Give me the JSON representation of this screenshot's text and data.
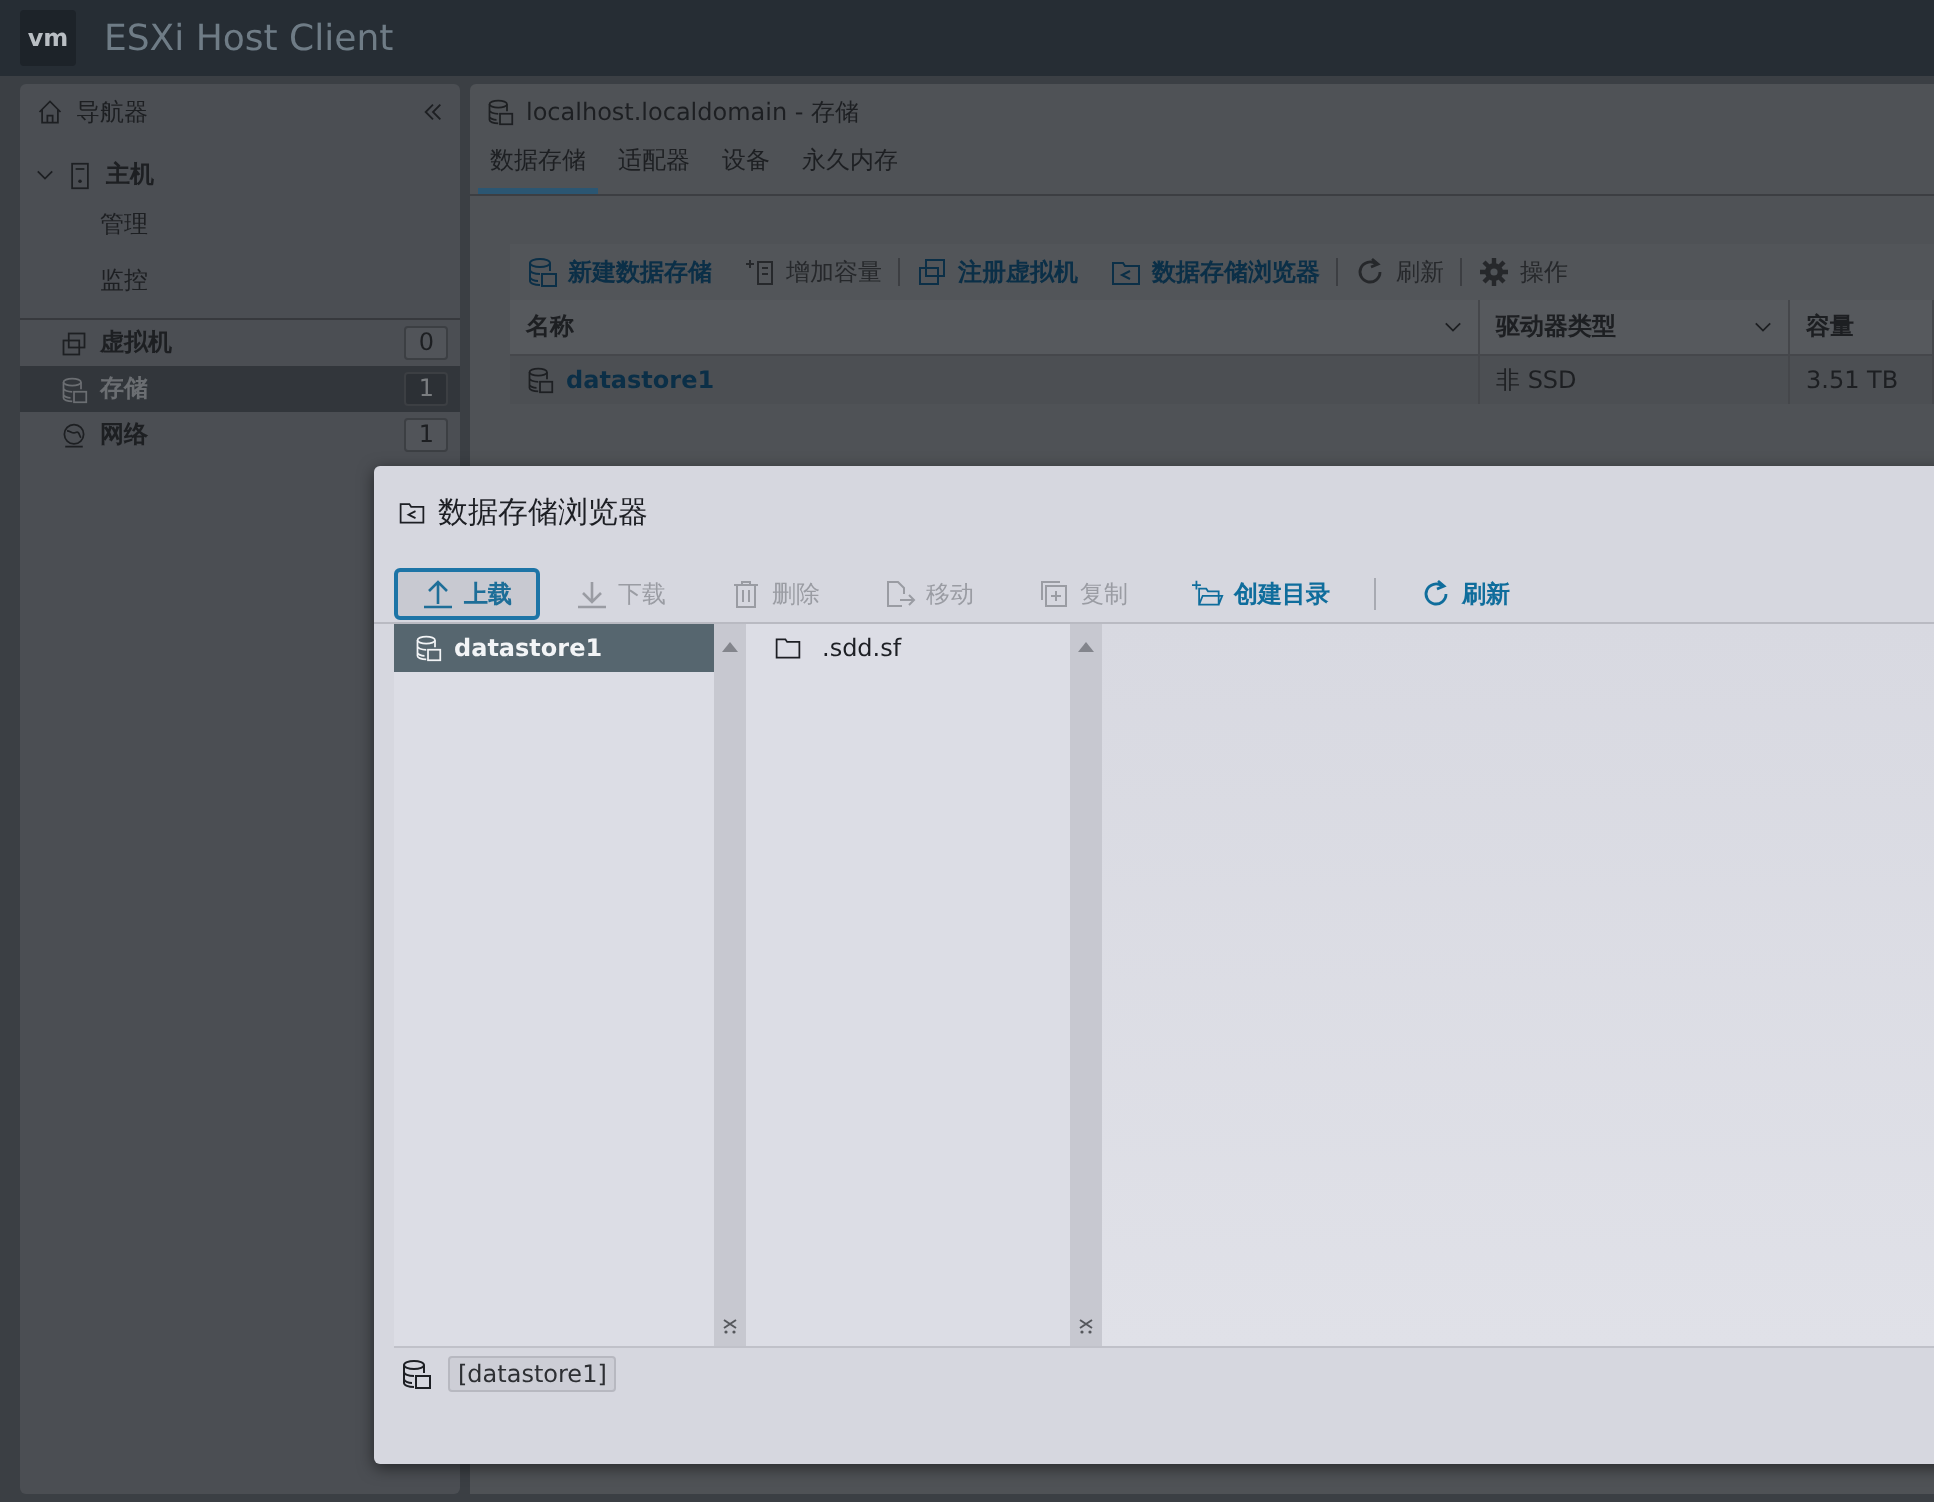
{
  "header": {
    "logo": "vm",
    "title": "ESXi Host Client"
  },
  "navigator": {
    "title": "导航器",
    "items": [
      {
        "kind": "host",
        "label": "主机",
        "expanded": true,
        "selected": false,
        "children": [
          {
            "label": "管理"
          },
          {
            "label": "监控"
          }
        ]
      },
      {
        "kind": "vm",
        "label": "虚拟机",
        "count": "0",
        "selected": false
      },
      {
        "kind": "storage",
        "label": "存储",
        "count": "1",
        "selected": true
      },
      {
        "kind": "network",
        "label": "网络",
        "count": "1",
        "selected": false
      }
    ]
  },
  "main": {
    "title": "localhost.localdomain - 存储",
    "tabs": [
      {
        "label": "数据存储",
        "selected": true
      },
      {
        "label": "适配器",
        "selected": false
      },
      {
        "label": "设备",
        "selected": false
      },
      {
        "label": "永久内存",
        "selected": false
      }
    ],
    "toolbar": [
      {
        "kind": "new",
        "label": "新建数据存储",
        "disabled": false
      },
      {
        "kind": "grow",
        "label": "增加容量",
        "disabled": true
      },
      {
        "kind": "sep"
      },
      {
        "kind": "register",
        "label": "注册虚拟机",
        "disabled": false
      },
      {
        "kind": "browser",
        "label": "数据存储浏览器",
        "disabled": false
      },
      {
        "kind": "sep"
      },
      {
        "kind": "refresh",
        "label": "刷新",
        "disabled": true
      },
      {
        "kind": "sep"
      },
      {
        "kind": "gear",
        "label": "操作",
        "disabled": true
      }
    ],
    "columns": [
      "名称",
      "驱动器类型",
      "容量"
    ],
    "rows": [
      [
        "datastore1",
        "非 SSD",
        "3.51 TB"
      ]
    ]
  },
  "dialog": {
    "title": "数据存储浏览器",
    "toolbar": [
      {
        "kind": "upload",
        "label": "上载",
        "disabled": false,
        "focused": true
      },
      {
        "kind": "download",
        "label": "下载",
        "disabled": true,
        "focused": false
      },
      {
        "kind": "delete",
        "label": "删除",
        "disabled": true,
        "focused": false
      },
      {
        "kind": "move",
        "label": "移动",
        "disabled": true,
        "focused": false
      },
      {
        "kind": "copy",
        "label": "复制",
        "disabled": true,
        "focused": false
      },
      {
        "kind": "mkdir",
        "label": "创建目录",
        "disabled": false,
        "focused": false
      },
      {
        "kind": "sep"
      },
      {
        "kind": "refresh",
        "label": "刷新",
        "disabled": false,
        "focused": false
      }
    ],
    "datastores": [
      {
        "label": "datastore1",
        "selected": true
      }
    ],
    "files": [
      {
        "label": ".sdd.sf",
        "selected": false
      }
    ],
    "path": "[datastore1]"
  }
}
